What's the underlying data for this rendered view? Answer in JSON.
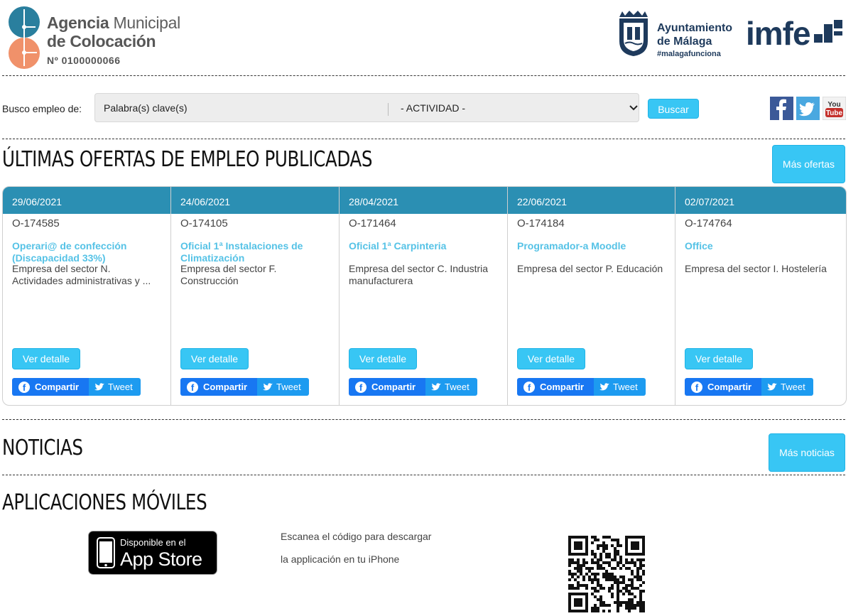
{
  "header": {
    "agency": {
      "line1_bold": "Agencia",
      "line1_rest": " Municipal",
      "line2": "de Colocación",
      "number": "Nº 0100000066"
    },
    "ayuntamiento": {
      "line1": "Ayuntamiento",
      "line2": "de Málaga",
      "tag": "#malagafunciona"
    },
    "imfe_logo_text": "imfe"
  },
  "search": {
    "label": "Busco empleo de:",
    "keyword_placeholder": "Palabra(s) clave(s)",
    "activity_selected": "- ACTIVIDAD -",
    "button": "Buscar"
  },
  "social": {
    "icons": [
      "facebook-icon",
      "twitter-icon",
      "youtube-icon"
    ],
    "youtube_label_top": "You",
    "youtube_label_bottom": "Tube"
  },
  "offers_section": {
    "title": "ÚLTIMAS OFERTAS DE EMPLEO PUBLICADAS",
    "more_button": "Más ofertas",
    "items": [
      {
        "date": "29/06/2021",
        "code": "O-174585",
        "title": "Operari@ de confección (Discapacidad 33%)",
        "company": "Empresa del sector N. Actividades administrativas y ...",
        "detail_button": "Ver detalle",
        "share_label": "Compartir",
        "tweet_label": "Tweet"
      },
      {
        "date": "24/06/2021",
        "code": "O-174105",
        "title": "Oficial 1ª Instalaciones de Climatización",
        "company": "Empresa del sector F. Construcción",
        "detail_button": "Ver detalle",
        "share_label": "Compartir",
        "tweet_label": "Tweet"
      },
      {
        "date": "28/04/2021",
        "code": "O-171464",
        "title": "Oficial 1ª Carpinteria",
        "company": "Empresa del sector C. Industria manufacturera",
        "detail_button": "Ver detalle",
        "share_label": "Compartir",
        "tweet_label": "Tweet"
      },
      {
        "date": "22/06/2021",
        "code": "O-174184",
        "title": "Programador-a Moodle",
        "company": "Empresa del sector P. Educación",
        "detail_button": "Ver detalle",
        "share_label": "Compartir",
        "tweet_label": "Tweet"
      },
      {
        "date": "02/07/2021",
        "code": "O-174764",
        "title": "Office",
        "company": "Empresa del sector I. Hostelería",
        "detail_button": "Ver detalle",
        "share_label": "Compartir",
        "tweet_label": "Tweet"
      }
    ]
  },
  "news_section": {
    "title": "NOTICIAS",
    "more_button": "Más noticias"
  },
  "apps_section": {
    "title": "APLICACIONES MÓVILES",
    "appstore_small": "Disponible en el",
    "appstore_big": "App Store",
    "scan_line1": "Escanea el código para descargar",
    "scan_line2": "la applicación en tu iPhone"
  },
  "colors": {
    "accent": "#38c6f4",
    "offer_header": "#2b8fb3",
    "offer_title": "#55c2e6",
    "brand_navy": "#1e3a5c",
    "agency_teal": "#2a7f9e",
    "agency_orange": "#f0916a",
    "facebook": "#1877f2",
    "twitter": "#1d9bf0"
  }
}
